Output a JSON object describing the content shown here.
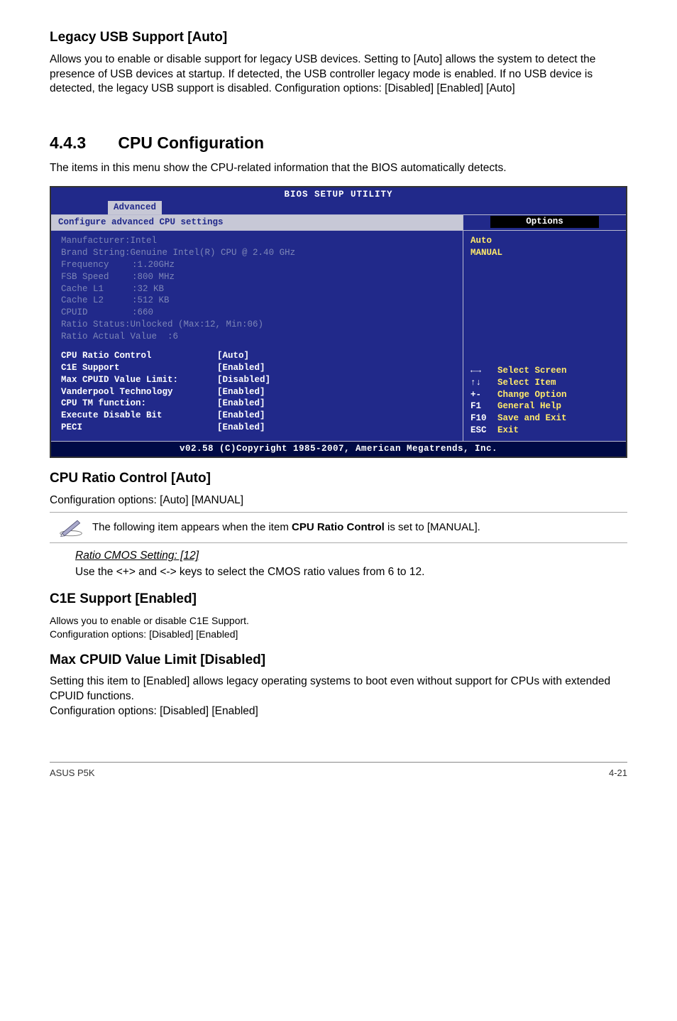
{
  "legacy": {
    "heading": "Legacy USB Support [Auto]",
    "body": "Allows you to enable or disable support for legacy USB devices. Setting to [Auto] allows the system to detect the presence of USB devices at startup. If detected, the USB controller legacy mode is enabled. If no USB device is detected, the legacy USB support is disabled. Configuration options: [Disabled] [Enabled] [Auto]"
  },
  "cpu_section": {
    "number": "4.4.3",
    "title": "CPU Configuration",
    "body": "The items in this menu show the CPU-related information that the BIOS automatically detects."
  },
  "bios": {
    "title": "BIOS SETUP UTILITY",
    "tab": "Advanced",
    "left_header": "Configure advanced CPU settings",
    "right_header": "Options",
    "info": {
      "manufacturer_label": "Manufacturer:",
      "manufacturer_val": "Intel",
      "brand_label": "Brand String:",
      "brand_val": "Genuine Intel(R) CPU @ 2.40 GHz",
      "freq_label": "Frequency",
      "freq_val": ":1.20GHz",
      "fsb_label": "FSB Speed",
      "fsb_val": ":800 MHz",
      "l1_label": "Cache L1",
      "l1_val": ":32 KB",
      "l2_label": "Cache L2",
      "l2_val": ":512 KB",
      "cpuid_label": "CPUID",
      "cpuid_val": ":660",
      "ratio_status": "Ratio Status:Unlocked (Max:12, Min:06)",
      "ratio_actual": "Ratio Actual Value  :6"
    },
    "items": [
      {
        "label": "CPU Ratio Control",
        "value": "[Auto]"
      },
      {
        "label": "C1E Support",
        "value": "[Enabled]"
      },
      {
        "label": "Max CPUID Value Limit:",
        "value": "[Disabled]"
      },
      {
        "label": "Vanderpool Technology",
        "value": "[Enabled]"
      },
      {
        "label": "CPU TM function:",
        "value": "[Enabled]"
      },
      {
        "label": "Execute Disable Bit",
        "value": "[Enabled]"
      },
      {
        "label": "PECI",
        "value": "[Enabled]"
      }
    ],
    "options": {
      "opt1": "Auto",
      "opt2": "MANUAL"
    },
    "nav": [
      {
        "key": "←→",
        "label": "Select Screen"
      },
      {
        "key": "↑↓",
        "label": "Select Item"
      },
      {
        "key": "+-",
        "label": "Change Option"
      },
      {
        "key": "F1",
        "label": "General Help"
      },
      {
        "key": "F10",
        "label": "Save and Exit"
      },
      {
        "key": "ESC",
        "label": "Exit"
      }
    ],
    "footer": "v02.58 (C)Copyright 1985-2007, American Megatrends, Inc."
  },
  "ratio": {
    "heading": "CPU Ratio Control [Auto]",
    "body": "Configuration options: [Auto] [MANUAL]",
    "note_pre": "The following item appears when the item ",
    "note_bold": "CPU Ratio Control",
    "note_post": " is set to [MANUAL].",
    "sub_heading": "Ratio CMOS Setting: [12]",
    "sub_body": "Use the <+> and <-> keys to select the CMOS ratio values from 6 to 12."
  },
  "c1e": {
    "heading": "C1E Support [Enabled]",
    "line1": "Allows you to enable or disable C1E Support.",
    "line2": "Configuration options: [Disabled] [Enabled]"
  },
  "maxcpuid": {
    "heading": "Max CPUID Value Limit [Disabled]",
    "body1": "Setting this item to [Enabled] allows legacy operating systems to boot even without support for CPUs with extended CPUID functions.",
    "body2": "Configuration options: [Disabled] [Enabled]"
  },
  "footer": {
    "left": "ASUS P5K",
    "right": "4-21"
  }
}
